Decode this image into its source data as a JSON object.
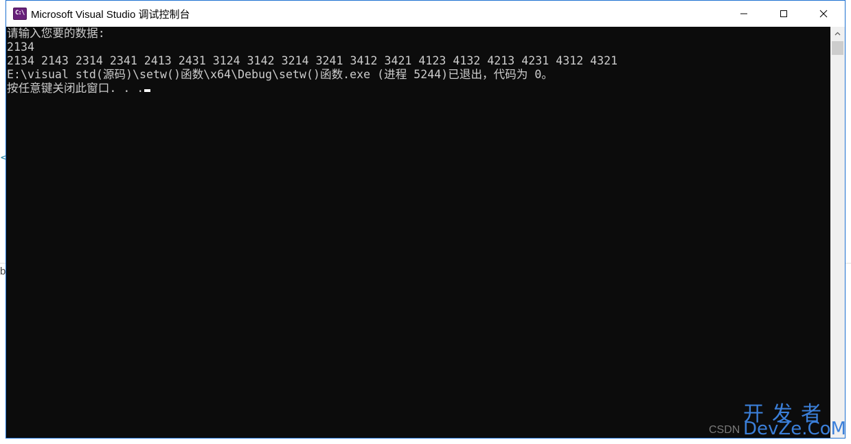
{
  "window": {
    "title": "Microsoft Visual Studio 调试控制台",
    "icon_text": "C:\\"
  },
  "console": {
    "lines": [
      "请输入您要的数据:",
      "2134",
      "2134 2143 2314 2341 2413 2431 3124 3142 3214 3241 3412 3421 4123 4132 4213 4231 4312 4321",
      "E:\\visual std(源码)\\setw()函数\\x64\\Debug\\setw()函数.exe (进程 5244)已退出，代码为 0。",
      "按任意键关闭此窗口. . ."
    ]
  },
  "background": {
    "left_letter": "b"
  },
  "watermark": {
    "top": "开发者",
    "bottom": "DevZe.CoM",
    "site": "CSDN"
  },
  "colors": {
    "console_bg": "#0c0c0c",
    "console_text": "#cccccc",
    "window_border": "#1b6fd1",
    "watermark": "#3b7fd9"
  },
  "icons": [
    "console-app-icon",
    "minimize-icon",
    "maximize-icon",
    "close-icon",
    "scroll-up-arrow-icon"
  ]
}
